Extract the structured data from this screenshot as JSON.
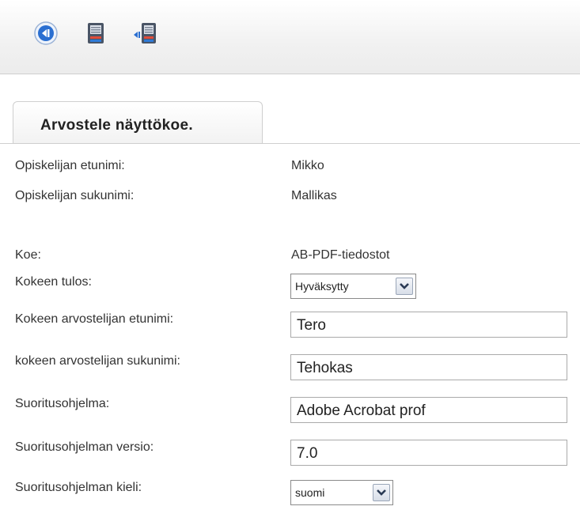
{
  "toolbar": {
    "buttons": [
      {
        "icon": "back-arrow-icon"
      },
      {
        "icon": "save-document-icon"
      },
      {
        "icon": "back-save-document-icon"
      }
    ]
  },
  "tab": {
    "label": "Arvostele näyttökoe."
  },
  "form": {
    "first_name": {
      "label": "Opiskelijan etunimi:",
      "value": "Mikko"
    },
    "last_name": {
      "label": "Opiskelijan sukunimi:",
      "value": "Mallikas"
    },
    "exam": {
      "label": "Koe:",
      "value": "AB-PDF-tiedostot"
    },
    "result": {
      "label": "Kokeen tulos:",
      "value": "Hyväksytty"
    },
    "grader_first": {
      "label": "Kokeen arvostelijan etunimi:",
      "value": "Tero"
    },
    "grader_last": {
      "label": "kokeen arvostelijan sukunimi:",
      "value": "Tehokas"
    },
    "program": {
      "label": "Suoritusohjelma:",
      "value": "Adobe Acrobat prof"
    },
    "program_version": {
      "label": "Suoritusohjelman versio:",
      "value": "7.0"
    },
    "program_language": {
      "label": "Suoritusohjelman kieli:",
      "value": "suomi"
    }
  },
  "colors": {
    "accent": "#2a6fd1",
    "border": "#cfcfcf"
  }
}
